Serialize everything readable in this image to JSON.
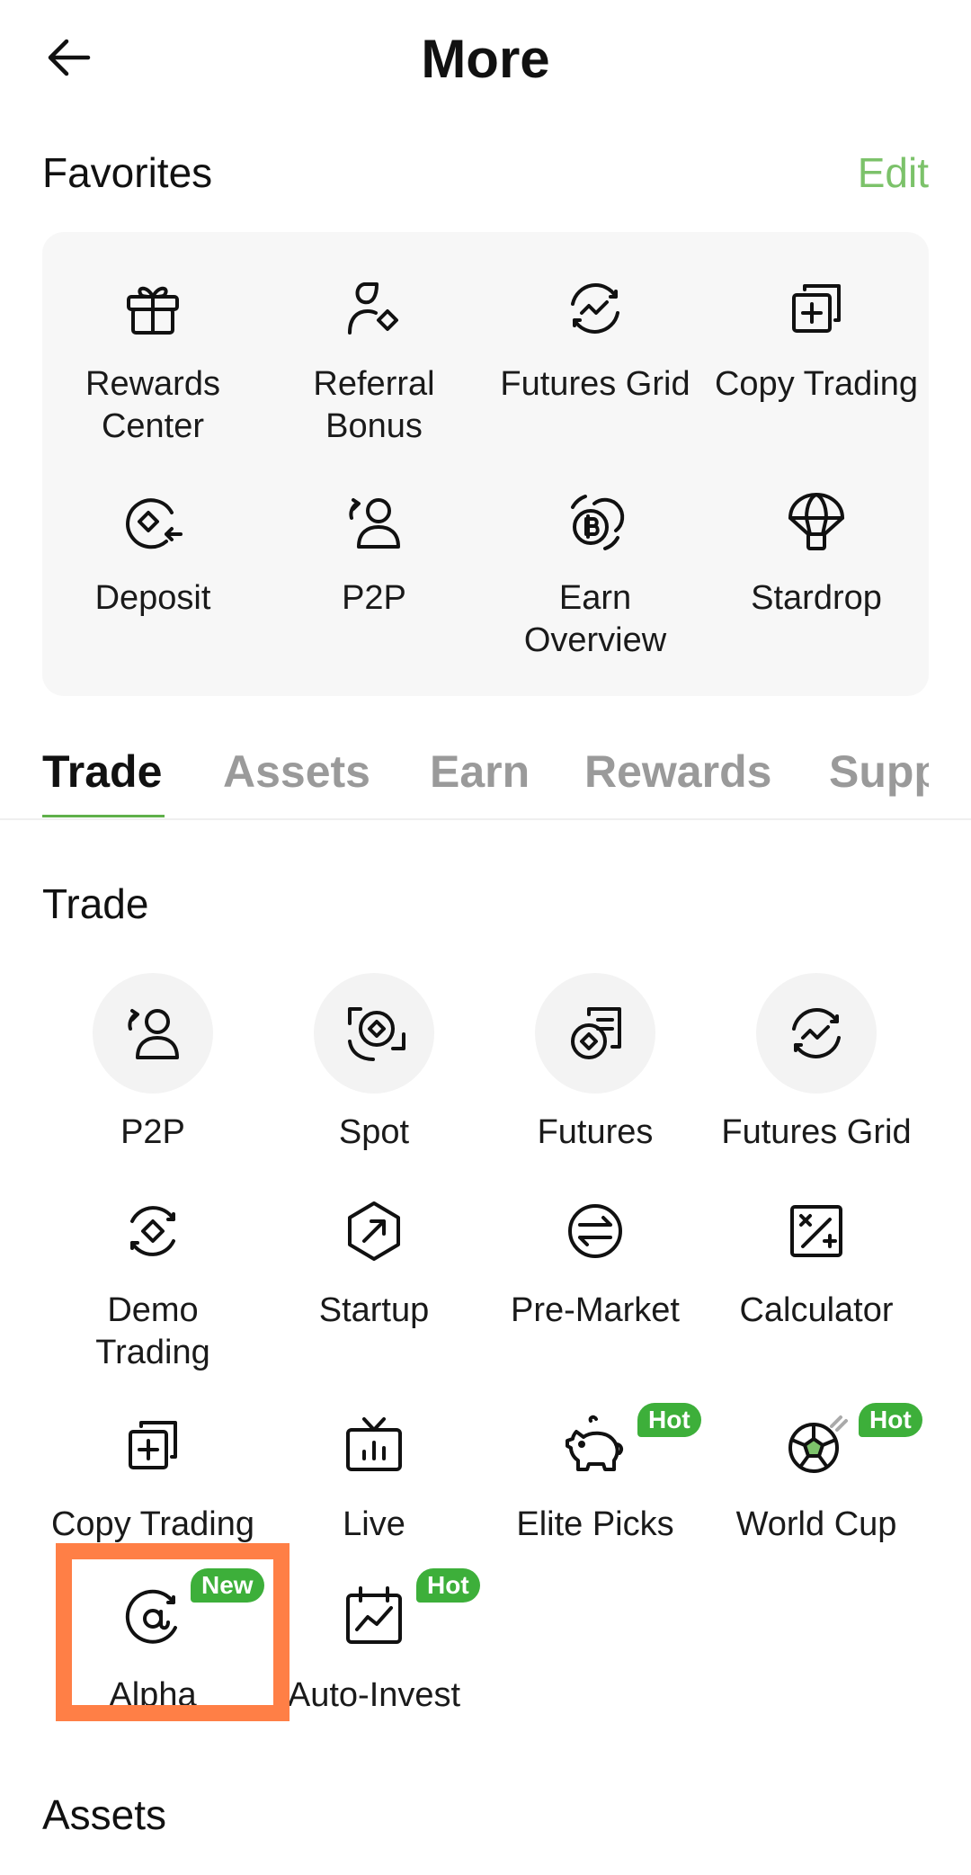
{
  "header": {
    "title": "More"
  },
  "favorites": {
    "title": "Favorites",
    "edit_label": "Edit",
    "items": [
      {
        "label": "Rewards\nCenter",
        "icon": "gift-icon"
      },
      {
        "label": "Referral\nBonus",
        "icon": "referral-icon"
      },
      {
        "label": "Futures Grid",
        "icon": "futures-grid-icon"
      },
      {
        "label": "Copy Trading",
        "icon": "copy-trading-icon"
      },
      {
        "label": "Deposit",
        "icon": "deposit-icon"
      },
      {
        "label": "P2P",
        "icon": "p2p-icon"
      },
      {
        "label": "Earn\nOverview",
        "icon": "earn-overview-icon"
      },
      {
        "label": "Stardrop",
        "icon": "stardrop-icon"
      }
    ]
  },
  "tabs": [
    {
      "label": "Trade",
      "active": true
    },
    {
      "label": "Assets",
      "active": false
    },
    {
      "label": "Earn",
      "active": false
    },
    {
      "label": "Rewards",
      "active": false
    },
    {
      "label": "Support",
      "active": false
    }
  ],
  "trade_section": {
    "title": "Trade",
    "items": [
      {
        "label": "P2P",
        "icon": "p2p-icon"
      },
      {
        "label": "Spot",
        "icon": "spot-icon"
      },
      {
        "label": "Futures",
        "icon": "futures-icon"
      },
      {
        "label": "Futures Grid",
        "icon": "futures-grid-icon"
      },
      {
        "label": "Demo\nTrading",
        "icon": "demo-trading-icon"
      },
      {
        "label": "Startup",
        "icon": "startup-icon"
      },
      {
        "label": "Pre-Market",
        "icon": "pre-market-icon"
      },
      {
        "label": "Calculator",
        "icon": "calculator-icon"
      },
      {
        "label": "Copy Trading",
        "icon": "copy-trading-icon"
      },
      {
        "label": "Live",
        "icon": "live-tv-icon"
      },
      {
        "label": "Elite Picks",
        "icon": "piggy-bank-icon",
        "badge": "Hot"
      },
      {
        "label": "World Cup",
        "icon": "soccer-ball-icon",
        "badge": "Hot"
      },
      {
        "label": "Alpha",
        "icon": "alpha-icon",
        "badge": "New"
      },
      {
        "label": "Auto-Invest",
        "icon": "auto-invest-icon",
        "badge": "Hot"
      }
    ]
  },
  "assets_section": {
    "title": "Assets"
  },
  "colors": {
    "accent": "#7cc26a",
    "badge": "#3daf3a",
    "highlight": "#ff7f46"
  }
}
